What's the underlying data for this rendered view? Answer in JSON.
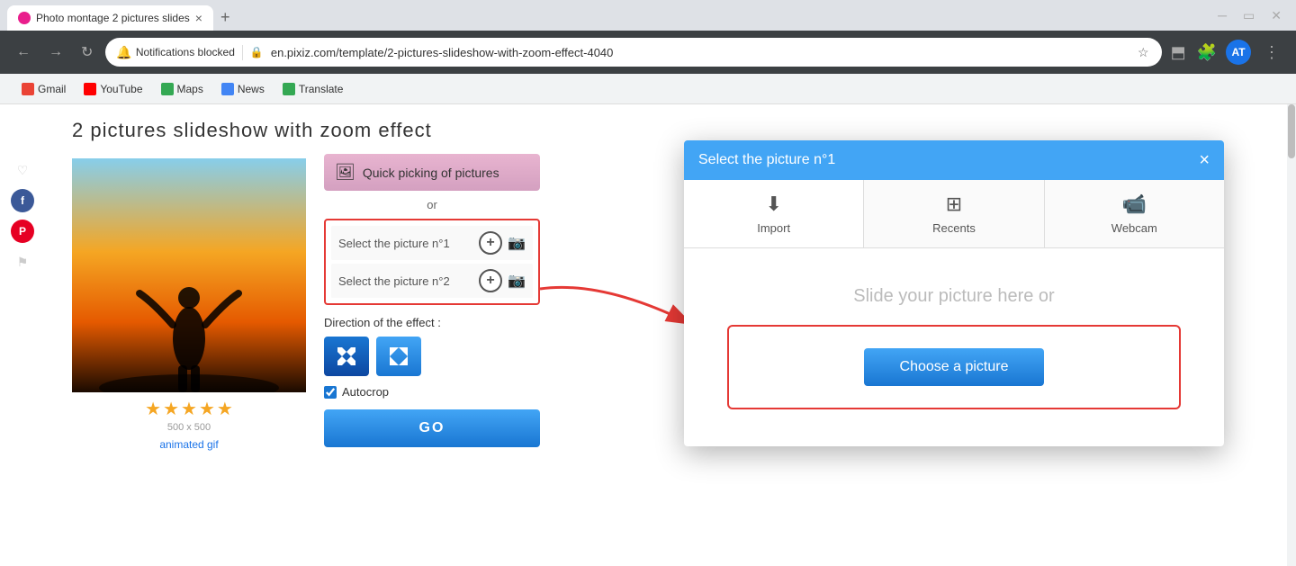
{
  "browser": {
    "tab": {
      "title": "Photo montage 2 pictures slides",
      "favicon": "P"
    },
    "address_bar": {
      "notifications_blocked": "Notifications blocked",
      "url": "en.pixiz.com/template/2-pictures-slideshow-with-zoom-effect-4040",
      "profile_initial": "AT"
    },
    "bookmarks": [
      {
        "label": "Gmail",
        "icon": "gmail"
      },
      {
        "label": "YouTube",
        "icon": "youtube"
      },
      {
        "label": "Maps",
        "icon": "maps"
      },
      {
        "label": "News",
        "icon": "news"
      },
      {
        "label": "Translate",
        "icon": "translate"
      }
    ]
  },
  "page": {
    "title": "2 pictures slideshow with zoom effect",
    "image_size": "500 x 500",
    "animated_gif_link": "animated gif",
    "stars": 5
  },
  "controls": {
    "quick_pick_label": "Quick picking of pictures",
    "or_text": "or",
    "select_pic1_label": "Select the picture n°1",
    "select_pic2_label": "Select the picture n°2",
    "direction_label": "Direction of the effect :",
    "autocrop_label": "Autocrop",
    "go_label": "GO"
  },
  "dialog": {
    "title": "Select the picture n°1",
    "close_label": "×",
    "tabs": [
      {
        "label": "Import",
        "icon": "⬇"
      },
      {
        "label": "Recents",
        "icon": "⊞"
      },
      {
        "label": "Webcam",
        "icon": "▶"
      }
    ],
    "slide_text": "Slide your picture here or",
    "choose_btn_label": "Choose a picture"
  }
}
